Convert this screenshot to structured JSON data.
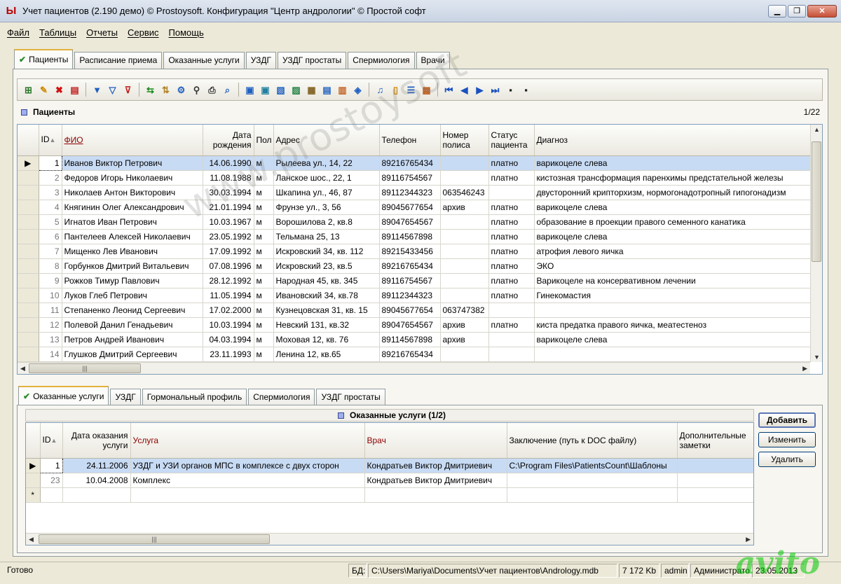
{
  "window": {
    "title": "Учет пациентов (2.190 демо) © Prostoysoft. Конфигурация \"Центр андрологии\" © Простой софт",
    "minimize": "▁",
    "maximize": "❐",
    "close": "✕"
  },
  "menu": [
    "Файл",
    "Таблицы",
    "Отчеты",
    "Сервис",
    "Помощь"
  ],
  "main_tabs": [
    {
      "label": "Пациенты",
      "active": true
    },
    {
      "label": "Расписание приема"
    },
    {
      "label": "Оказанные услуги"
    },
    {
      "label": "УЗДГ"
    },
    {
      "label": "УЗДГ простаты"
    },
    {
      "label": "Спермиология"
    },
    {
      "label": "Врачи"
    }
  ],
  "patients": {
    "title": "Пациенты",
    "counter": "1/22",
    "columns": {
      "id": "ID",
      "fio": "ФИО",
      "dob": "Дата рождения",
      "sex": "Пол",
      "address": "Адрес",
      "phone": "Телефон",
      "policy": "Номер полиса",
      "status": "Статус пациента",
      "diagnosis": "Диагноз"
    },
    "rows": [
      {
        "id": "1",
        "fio": "Иванов Виктор Петрович",
        "dob": "14.06.1990",
        "sex": "м",
        "address": "Рылеева ул., 14, 22",
        "phone": "89216765434",
        "policy": "",
        "status": "платно",
        "diagnosis": "варикоцеле слева"
      },
      {
        "id": "2",
        "fio": "Федоров Игорь Николаевич",
        "dob": "11.08.1988",
        "sex": "м",
        "address": "Ланское шос., 22, 1",
        "phone": "89116754567",
        "policy": "",
        "status": "платно",
        "diagnosis": "кистозная трансформация паренхимы предстательной железы"
      },
      {
        "id": "3",
        "fio": "Николаев Антон Викторович",
        "dob": "30.03.1994",
        "sex": "м",
        "address": "Шкапина ул., 46, 87",
        "phone": "89112344323",
        "policy": "063546243",
        "status": "",
        "diagnosis": "двусторонний крипторхизм, нормогонадотропный гипогонадизм"
      },
      {
        "id": "4",
        "fio": "Княгинин Олег Александрович",
        "dob": "21.01.1994",
        "sex": "м",
        "address": "Фрунзе ул., 3, 56",
        "phone": "89045677654",
        "policy": "архив",
        "status": "платно",
        "diagnosis": "варикоцеле слева"
      },
      {
        "id": "5",
        "fio": "Игнатов Иван Петрович",
        "dob": "10.03.1967",
        "sex": "м",
        "address": "Ворошилова 2, кв.8",
        "phone": "89047654567",
        "policy": "",
        "status": "платно",
        "diagnosis": "образование в проекции правого семенного канатика"
      },
      {
        "id": "6",
        "fio": "Пантелеев Алексей Николаевич",
        "dob": "23.05.1992",
        "sex": "м",
        "address": "Тельмана 25, 13",
        "phone": "89114567898",
        "policy": "",
        "status": "платно",
        "diagnosis": "варикоцеле слева"
      },
      {
        "id": "7",
        "fio": "Мищенко Лев Иванович",
        "dob": "17.09.1992",
        "sex": "м",
        "address": "Искровский 34, кв. 112",
        "phone": "89215433456",
        "policy": "",
        "status": "платно",
        "diagnosis": "атрофия левого яичка"
      },
      {
        "id": "8",
        "fio": "Горбунков Дмитрий Витальевич",
        "dob": "07.08.1996",
        "sex": "м",
        "address": "Искровский 23, кв.5",
        "phone": "89216765434",
        "policy": "",
        "status": "платно",
        "diagnosis": "ЭКО"
      },
      {
        "id": "9",
        "fio": "Рожков Тимур Павлович",
        "dob": "28.12.1992",
        "sex": "м",
        "address": "Народная 45, кв. 345",
        "phone": "89116754567",
        "policy": "",
        "status": "платно",
        "diagnosis": "Варикоцеле на консервативном лечении"
      },
      {
        "id": "10",
        "fio": "Луков Глеб Петрович",
        "dob": "11.05.1994",
        "sex": "м",
        "address": "Ивановский 34, кв.78",
        "phone": "89112344323",
        "policy": "",
        "status": "платно",
        "diagnosis": "Гинекомастия"
      },
      {
        "id": "11",
        "fio": "Степаненко Леонид Сергеевич",
        "dob": "17.02.2000",
        "sex": "м",
        "address": "Кузнецовская 31, кв. 15",
        "phone": "89045677654",
        "policy": "063747382",
        "status": "",
        "diagnosis": ""
      },
      {
        "id": "12",
        "fio": "Полевой Данил Генадьевич",
        "dob": "10.03.1994",
        "sex": "м",
        "address": "Невский 131, кв.32",
        "phone": "89047654567",
        "policy": "архив",
        "status": "платно",
        "diagnosis": "киста предатка правого яичка, меатестеноз"
      },
      {
        "id": "13",
        "fio": "Петров Андрей Иванович",
        "dob": "04.03.1994",
        "sex": "м",
        "address": "Моховая 12, кв. 76",
        "phone": "89114567898",
        "policy": "архив",
        "status": "",
        "diagnosis": "варикоцеле слева"
      },
      {
        "id": "14",
        "fio": "Глушков Дмитрий Сергеевич",
        "dob": "23.11.1993",
        "sex": "м",
        "address": "Ленина 12, кв.65",
        "phone": "89216765434",
        "policy": "",
        "status": "",
        "diagnosis": ""
      }
    ]
  },
  "sub_tabs": [
    {
      "label": "Оказанные услуги",
      "active": true
    },
    {
      "label": "УЗДГ"
    },
    {
      "label": "Гормональный профиль"
    },
    {
      "label": "Спермиология"
    },
    {
      "label": "УЗДГ простаты"
    }
  ],
  "services": {
    "title": "Оказанные услуги (1/2)",
    "columns": {
      "id": "ID",
      "date": "Дата оказания услуги",
      "service": "Услуга",
      "doctor": "Врач",
      "conclusion": "Заключение (путь к DOC файлу)",
      "notes": "Дополнительные заметки"
    },
    "rows": [
      {
        "id": "1",
        "date": "24.11.2006",
        "service": "УЗДГ и УЗИ органов МПС в комплексе с двух сторон",
        "doctor": "Кондратьев Виктор Дмитриевич",
        "conclusion": "C:\\Program Files\\PatientsCount\\Шаблоны",
        "notes": ""
      },
      {
        "id": "23",
        "date": "10.04.2008",
        "service": "Комплекс",
        "doctor": "Кондратьев Виктор Дмитриевич",
        "conclusion": "",
        "notes": ""
      }
    ],
    "new_row_marker": "*"
  },
  "buttons": {
    "add": "Добавить",
    "edit": "Изменить",
    "delete": "Удалить"
  },
  "status": {
    "ready": "Готово",
    "db_label": "БД:",
    "db_path": "C:\\Users\\Mariya\\Documents\\Учет пациентов\\Andrology.mdb",
    "size": "7 172 Kb",
    "user": "admin",
    "role": "Администратор",
    "date": "23.05.2013"
  },
  "watermark": "www.prostoysoft",
  "logo": "avito",
  "toolbar_icons": [
    "add-record-icon",
    "edit-icon",
    "delete-icon",
    "copy-icon",
    "filter-icon",
    "filter-add-icon",
    "filter-remove-icon",
    "refresh-icon",
    "sort-icon",
    "filter-settings-icon",
    "find-icon",
    "print-icon",
    "preview-icon",
    "export1-icon",
    "export2-icon",
    "export3-icon",
    "export4-icon",
    "export5-icon",
    "export6-icon",
    "export7-icon",
    "export8-icon",
    "report1-icon",
    "report2-icon",
    "report3-icon",
    "report4-icon",
    "first-icon",
    "prev-icon",
    "next-icon",
    "last-icon",
    "save-icon",
    "cancel-icon"
  ]
}
